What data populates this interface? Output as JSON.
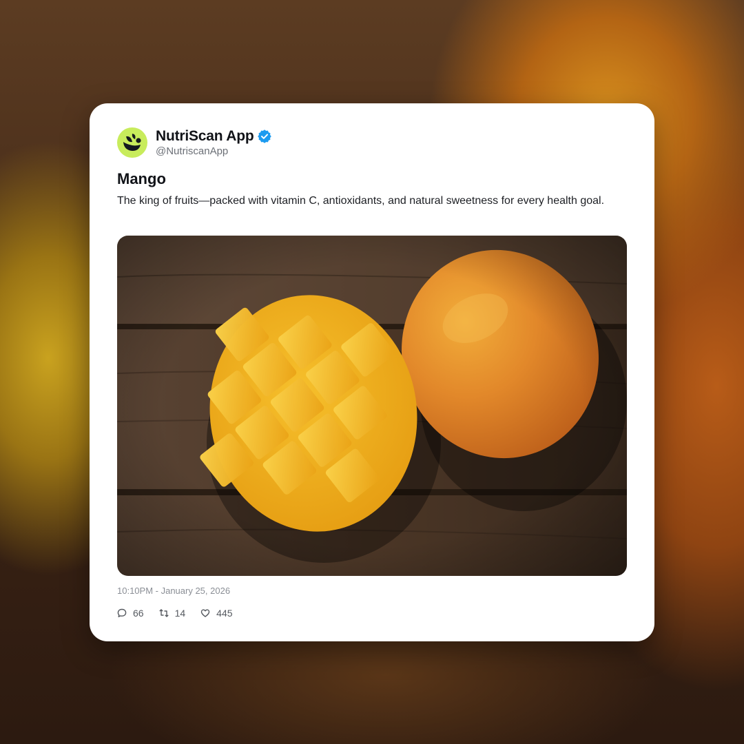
{
  "post": {
    "author": {
      "name": "NutriScan App",
      "handle": "@NutriscanApp",
      "verified": true,
      "avatar_color": "#c8ec5c"
    },
    "title": "Mango",
    "text": "The king of fruits—packed with vitamin C, antioxidants, and natural sweetness for every health goal.",
    "image": {
      "subject": "mango-photo"
    },
    "timestamp": "10:10PM - January 25, 2026",
    "stats": {
      "replies": "66",
      "reposts": "14",
      "likes": "445"
    }
  },
  "icons": {
    "verified": "verified-badge-icon",
    "replies": "comment-icon",
    "reposts": "retweet-icon",
    "likes": "heart-icon"
  },
  "colors": {
    "verified_badge": "#1d9bf0",
    "card_background": "#ffffff",
    "title_text": "#111318",
    "meta_text": "#8a8e95"
  }
}
